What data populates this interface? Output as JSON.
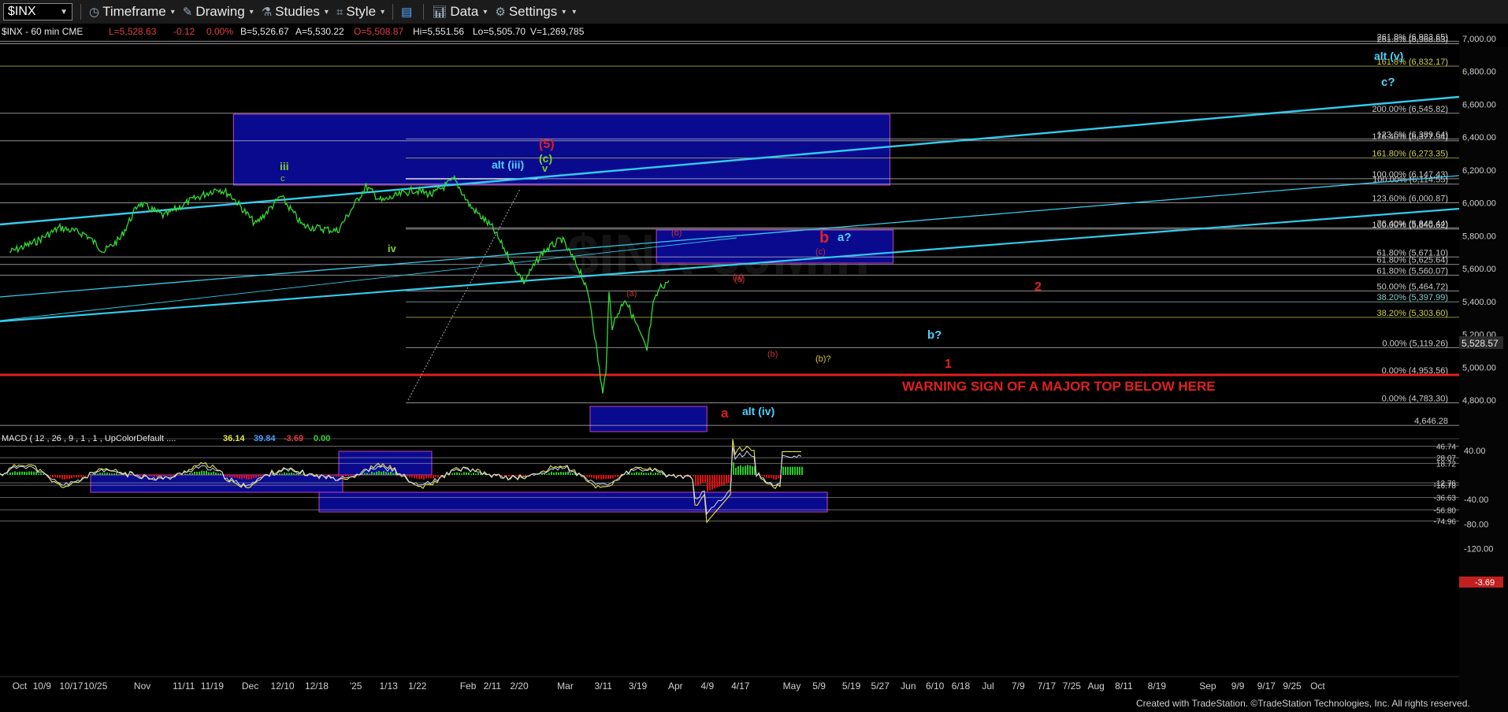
{
  "toolbar": {
    "symbol": "$INX",
    "items": [
      {
        "label": "Timeframe",
        "icon": "clock-icon"
      },
      {
        "label": "Drawing",
        "icon": "pencil-icon"
      },
      {
        "label": "Studies",
        "icon": "flask-icon"
      },
      {
        "label": "Style",
        "icon": "style-icon"
      },
      {
        "label": "",
        "icon": "layout-icon"
      },
      {
        "label": "Data",
        "icon": "bar-chart-icon"
      },
      {
        "label": "Settings",
        "icon": "gear-icon"
      }
    ]
  },
  "header": {
    "symbol_info": "$INX - 60 min  CME",
    "last": "L=5,528.63",
    "chg": "-0.12",
    "pct": "0.00%",
    "bid": "B=5,526.67",
    "ask": "A=5,530.22",
    "open": "O=5,508.87",
    "hi": "Hi=5,551.56",
    "lo": "Lo=5,505.70",
    "vol": "V=1,269,785"
  },
  "chart_data": {
    "type": "line",
    "price_axis": {
      "ticks": [
        "7,000.00",
        "6,800.00",
        "6,600.00",
        "6,400.00",
        "6,200.00",
        "6,000.00",
        "5,800.00",
        "5,600.00",
        "5,400.00",
        "5,200.00",
        "5,000.00",
        "4,800.00"
      ],
      "last_price": "5,528.57",
      "ylim": [
        4600,
        7050
      ]
    },
    "macd_axis": {
      "ticks": [
        "40.00",
        "-40.00",
        "-80.00",
        "-120.00"
      ],
      "levels": [
        "46.74",
        "28.07",
        "18.72",
        "-12.76",
        "-16.78",
        "-36.63",
        "-56.80",
        "-74.96"
      ],
      "last_value": "-3.69"
    },
    "macd_header": {
      "label": "MACD ( 12 , 26 , 9 , 1 , 1 , UpColorDefault ....",
      "v1": "36.14",
      "v2": "39.84",
      "v3": "-3.69",
      "v4": "0.00"
    },
    "x_ticks": [
      "Oct",
      "10/9",
      "10/17",
      "10/25",
      "Nov",
      "11/11",
      "11/19",
      "Dec",
      "12/10",
      "12/18",
      "'25",
      "1/13",
      "1/22",
      "Feb",
      "2/11",
      "2/20",
      "Mar",
      "3/11",
      "3/19",
      "Apr",
      "4/9",
      "4/17",
      "May",
      "5/9",
      "5/19",
      "5/27",
      "Jun",
      "6/10",
      "6/18",
      "Jul",
      "7/9",
      "7/17",
      "7/25",
      "Aug",
      "8/11",
      "8/19",
      "Sep",
      "9/9",
      "9/17",
      "9/25",
      "Oct"
    ],
    "price_series": [
      [
        "2024-10-01",
        5700
      ],
      [
        "2024-10-09",
        5760
      ],
      [
        "2024-10-17",
        5850
      ],
      [
        "2024-10-25",
        5810
      ],
      [
        "2024-10-31",
        5705
      ],
      [
        "2024-11-05",
        5780
      ],
      [
        "2024-11-11",
        6000
      ],
      [
        "2024-11-19",
        5920
      ],
      [
        "2024-11-27",
        6010
      ],
      [
        "2024-12-06",
        6090
      ],
      [
        "2024-12-10",
        6050
      ],
      [
        "2024-12-18",
        5870
      ],
      [
        "2024-12-26",
        6040
      ],
      [
        "2025-01-02",
        5860
      ],
      [
        "2025-01-13",
        5830
      ],
      [
        "2025-01-22",
        6100
      ],
      [
        "2025-01-27",
        6010
      ],
      [
        "2025-02-06",
        6080
      ],
      [
        "2025-02-12",
        6050
      ],
      [
        "2025-02-19",
        6144
      ],
      [
        "2025-02-24",
        5980
      ],
      [
        "2025-03-03",
        5850
      ],
      [
        "2025-03-10",
        5610
      ],
      [
        "2025-03-13",
        5520
      ],
      [
        "2025-03-19",
        5700
      ],
      [
        "2025-03-25",
        5780
      ],
      [
        "2025-03-31",
        5580
      ],
      [
        "2025-04-03",
        5400
      ],
      [
        "2025-04-07",
        4835
      ],
      [
        "2025-04-08",
        4980
      ],
      [
        "2025-04-09",
        5450
      ],
      [
        "2025-04-10",
        5250
      ],
      [
        "2025-04-14",
        5420
      ],
      [
        "2025-04-17",
        5290
      ],
      [
        "2025-04-21",
        5100
      ],
      [
        "2025-04-23",
        5380
      ],
      [
        "2025-04-25",
        5480
      ],
      [
        "2025-04-28",
        5528
      ]
    ],
    "fib_levels": [
      {
        "label": "261.8% (6,983.65)",
        "value": 6983.65
      },
      {
        "label": "261.8% (6,968.63)",
        "value": 6968.63
      },
      {
        "label": "161.8% (6,832.17)",
        "value": 6832.17
      },
      {
        "label": "200.00% (6,545.82)",
        "value": 6545.82
      },
      {
        "label": "123.6% (6,389.64)",
        "value": 6389.64
      },
      {
        "label": "176.40% (6,377.94)",
        "value": 6377.94
      },
      {
        "label": "161.80% (6,273.35)",
        "value": 6273.35
      },
      {
        "label": "100.00% (6,147.43)",
        "value": 6147.43
      },
      {
        "label": "100.00% (6,114.55)",
        "value": 6114.55
      },
      {
        "label": "123.60% (6,000.87)",
        "value": 6000.87
      },
      {
        "label": "76.40% (5,848.44)",
        "value": 5848.44
      },
      {
        "label": "100.00% (5,840.62)",
        "value": 5840.62
      },
      {
        "label": "61.80% (5,671.10)",
        "value": 5671.1
      },
      {
        "label": "61.80% (5,625.64)",
        "value": 5625.64
      },
      {
        "label": "61.80% (5,560.07)",
        "value": 5560.07
      },
      {
        "label": "50.00% (5,464.72)",
        "value": 5464.72
      },
      {
        "label": "38.20% (5,397.99)",
        "value": 5397.99
      },
      {
        "label": "38.20% (5,303.60)",
        "value": 5303.6
      },
      {
        "label": "0.00% (5,119.26)",
        "value": 5119.26
      },
      {
        "label": "0.00% (4,953.56)",
        "value": 4953.56
      },
      {
        "label": "0.00% (4,783.30)",
        "value": 4783.3
      },
      {
        "label": "4,646.28",
        "value": 4646.28
      }
    ],
    "annotations": {
      "warning": "WARNING SIGN OF A MAJOR TOP BELOW HERE",
      "labels": [
        "iii",
        "c",
        "iv",
        "alt (iii)",
        "(5)",
        "(c)",
        "v",
        "(a)",
        "(b)",
        "(a)",
        "b",
        "(c)",
        "a?",
        "(a)",
        "(b)",
        "(b)?",
        "a",
        "alt (iv)",
        "alt (v)",
        "c?",
        "b?",
        "1",
        "2"
      ]
    }
  },
  "footer": {
    "credit": "Created with TradeStation. ©TradeStation Technologies, Inc. All rights reserved."
  },
  "colors": {
    "price": "#33dd33",
    "channel": "#33ccee",
    "box": "#0a0a8f",
    "warning": "#e02020",
    "fib_a": "#cccccc",
    "fib_b": "#cfcf55",
    "fib_c": "#88cccc"
  }
}
